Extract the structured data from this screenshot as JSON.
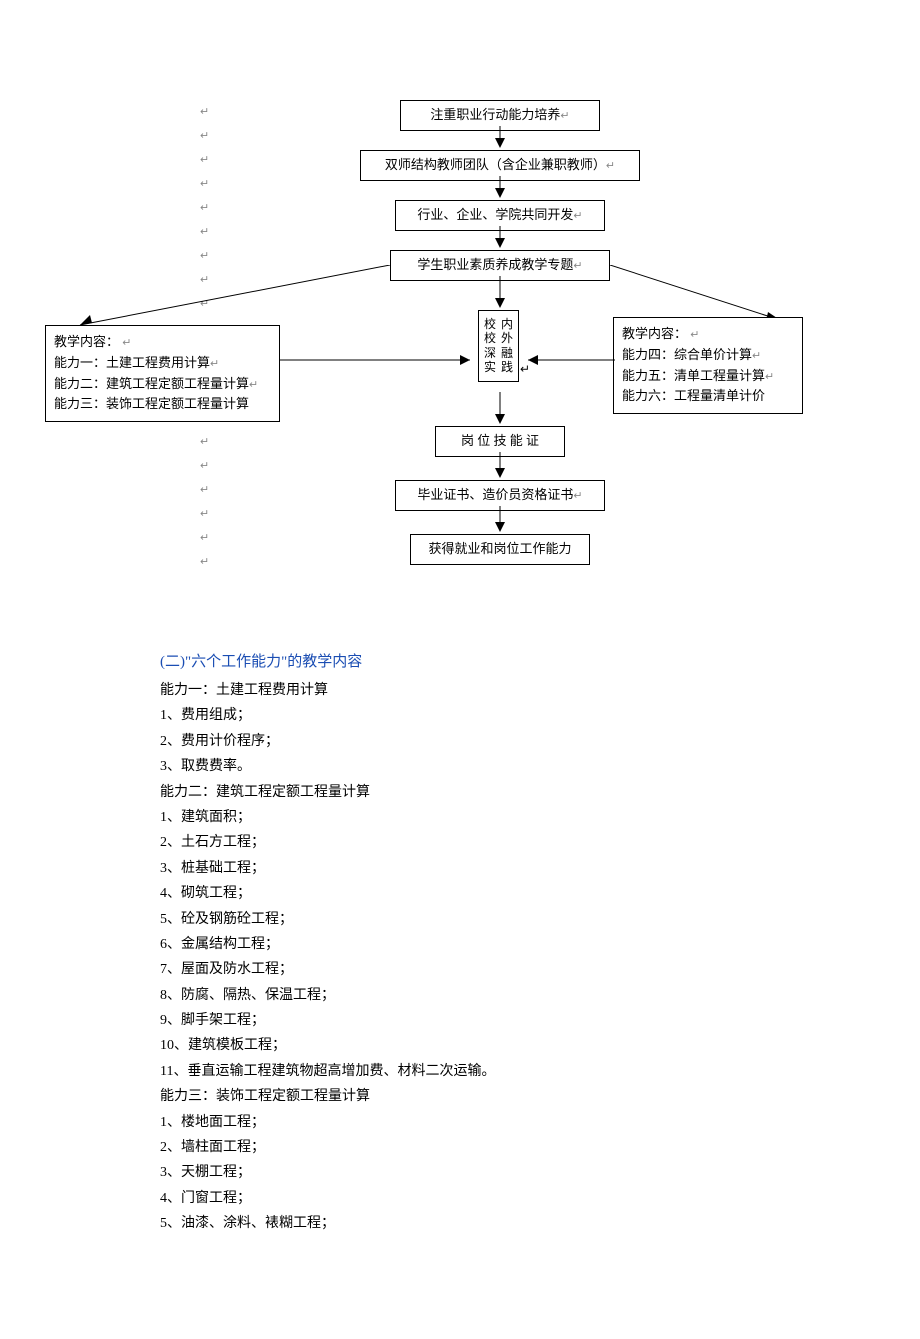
{
  "diagram": {
    "topBoxes": [
      "注重职业行动能力培养",
      "双师结构教师团队（含企业兼职教师）",
      "行业、企业、学院共同开发",
      "学生职业素质养成教学专题"
    ],
    "leftBox": {
      "title": "教学内容：",
      "items": [
        "能力一：土建工程费用计算",
        "能力二：建筑工程定额工程量计算",
        "能力三：装饰工程定额工程量计算"
      ]
    },
    "rightBox": {
      "title": "教学内容：",
      "items": [
        "能力四：综合单价计算",
        "能力五：清单工程量计算",
        "能力六：工程量清单计价"
      ]
    },
    "centerBox": {
      "col1": "校校深实",
      "col2": "内外融践"
    },
    "bottomBoxes": [
      "岗 位 技 能 证",
      "毕业证书、造价员资格证书",
      "获得就业和岗位工作能力"
    ]
  },
  "section": {
    "heading": "(二)\"六个工作能力\"的教学内容",
    "groups": [
      {
        "title": "能力一：土建工程费用计算",
        "items": [
          "1、费用组成；",
          "2、费用计价程序；",
          "3、取费费率。"
        ]
      },
      {
        "title": "能力二：建筑工程定额工程量计算",
        "items": [
          "1、建筑面积；",
          "2、土石方工程；",
          "3、桩基础工程；",
          "4、砌筑工程；",
          "5、砼及钢筋砼工程；",
          "6、金属结构工程；",
          "7、屋面及防水工程；",
          "8、防腐、隔热、保温工程；",
          "9、脚手架工程；",
          "10、建筑模板工程；",
          "11、垂直运输工程建筑物超高增加费、材料二次运输。"
        ]
      },
      {
        "title": "能力三：装饰工程定额工程量计算",
        "items": [
          "1、楼地面工程；",
          "2、墙柱面工程；",
          "3、天棚工程；",
          "4、门窗工程；",
          "5、油漆、涂料、裱糊工程；"
        ]
      }
    ]
  }
}
